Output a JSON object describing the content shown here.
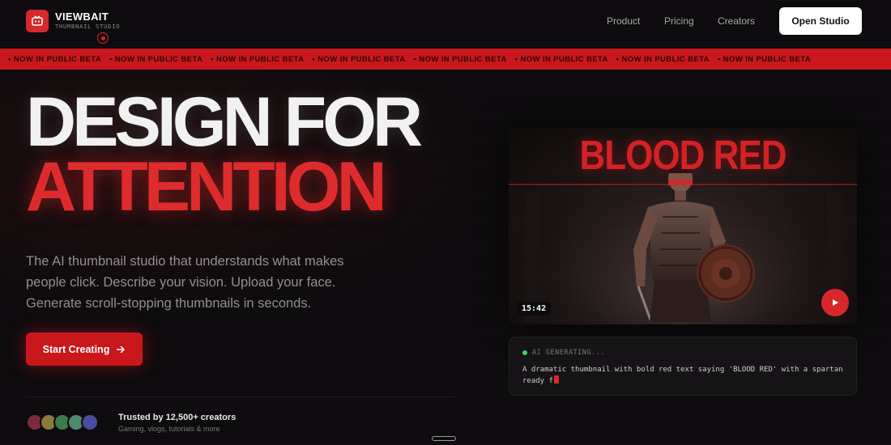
{
  "brand": {
    "name": "VIEWBAIT",
    "subtitle": "THUMBNAIL STUDIO"
  },
  "nav": {
    "links": [
      "Product",
      "Pricing",
      "Creators"
    ],
    "cta": "Open Studio"
  },
  "ticker": {
    "text": "NOW IN PUBLIC BETA",
    "repeat": 8
  },
  "hero": {
    "line1": "DESIGN FOR",
    "line2": "ATTENTION",
    "description": "The AI thumbnail studio that understands what makes people click. Describe your vision. Upload your face. Generate scroll-stopping thumbnails in seconds.",
    "cta": "Start Creating"
  },
  "trust": {
    "title": "Trusted by 12,500+ creators",
    "subtitle": "Gaming, vlogs, tutorials & more",
    "avatar_colors": [
      "#7a2a3a",
      "#8a7a3a",
      "#3a7a4a",
      "#4a8a6a",
      "#4a4aa0"
    ]
  },
  "preview": {
    "thumbnail_title": "BLOOD RED",
    "timecode": "15:42",
    "status": "AI GENERATING...",
    "prompt": "A dramatic thumbnail with bold red text saying 'BLOOD RED' with a spartan ready f"
  },
  "colors": {
    "accent": "#d7262a",
    "background": "#0c0a0c",
    "status_green": "#3ad26a"
  }
}
